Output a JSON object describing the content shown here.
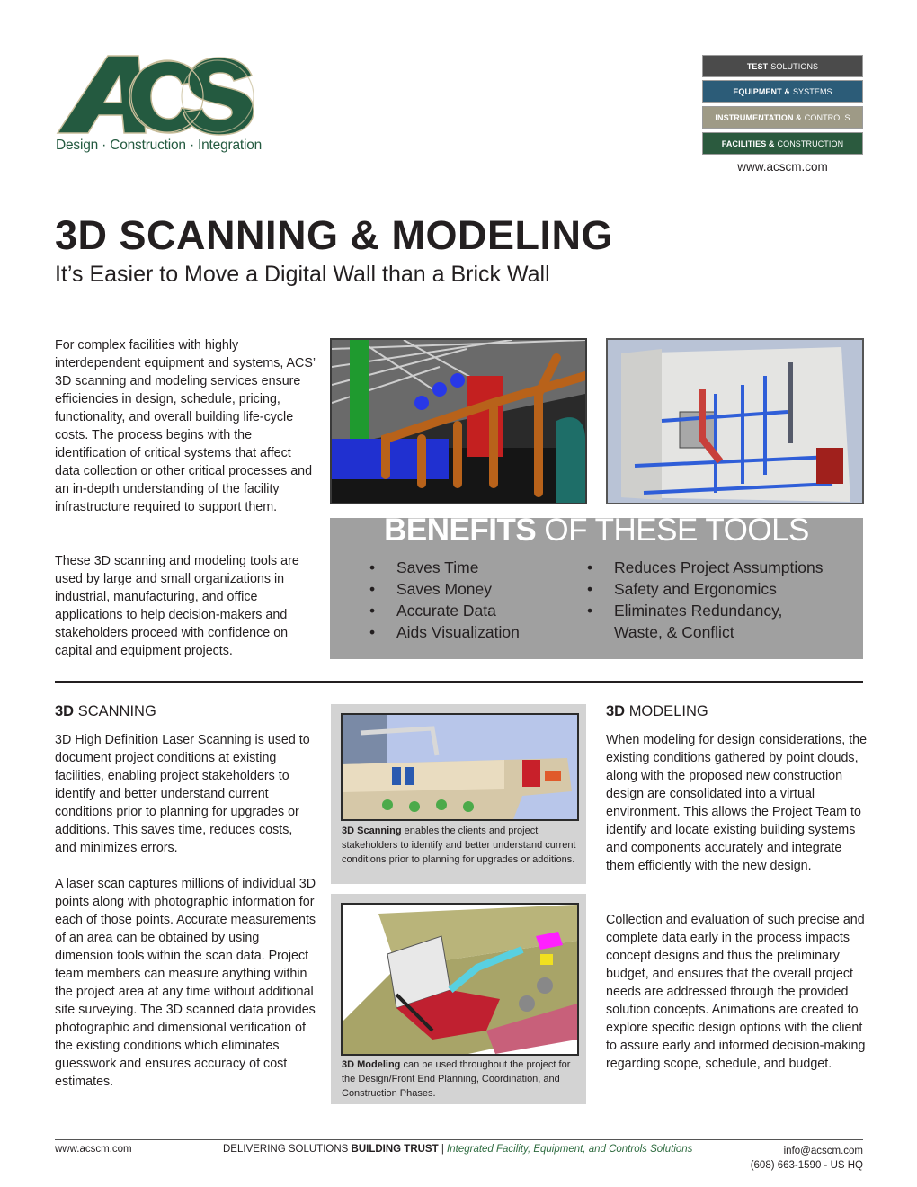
{
  "brand": {
    "logo_text": "ACS",
    "tagline": "Design · Construction · Integration",
    "colors": {
      "green": "#245a40",
      "tan": "#c8bd9a",
      "gray_dark": "#4b4b4b",
      "blue": "#2c5c78",
      "khaki": "#9e9a86",
      "green_badge": "#2b5a3e",
      "benefits_bg": "#a0a0a0",
      "figcard_bg": "#d3d3d3",
      "footer_italic": "#2e6b3f"
    }
  },
  "divisions": [
    {
      "bold": "TEST",
      "light": "SOLUTIONS",
      "color": "#4b4b4b"
    },
    {
      "bold": "EQUIPMENT &",
      "light": "SYSTEMS",
      "color": "#2c5c78"
    },
    {
      "bold": "INSTRUMENTATION &",
      "light": "CONTROLS",
      "color": "#9e9a86"
    },
    {
      "bold": "FACILITIES &",
      "light": "CONSTRUCTION",
      "color": "#2b5a3e"
    }
  ],
  "website": "www.acscm.com",
  "header": {
    "title": "3D SCANNING & MODELING",
    "subtitle": "It’s Easier to Move a Digital Wall than a Brick Wall"
  },
  "intro": {
    "paragraph1": "For complex facilities with highly interdependent equipment and systems, ACS’ 3D scanning and modeling services ensure efficiencies in design, schedule, pricing, functionality, and overall building life-cycle costs. The process begins with the identification of critical systems that affect data collection or other critical processes and an in-depth understanding of the facility infrastructure required to support them.",
    "paragraph2": "These 3D scanning and modeling tools are used by large and small organizations in industrial, manufacturing, and office applications to help decision-makers and stakeholders proceed with confidence on capital and equipment projects."
  },
  "images": {
    "top_left": "3D BIM model of overhead piping and ductwork",
    "top_right": "3D laser scan point cloud of mechanical room wall",
    "scan_fig": "3D scan point cloud of facility cross-section",
    "model_fig": "3D model of industrial building layout"
  },
  "benefits": {
    "title_bold": "BENEFITS",
    "title_light": "OF THESE TOOLS",
    "bullet": "•",
    "left": [
      "Saves Time",
      "Saves Money",
      "Accurate Data",
      "Aids Visualization"
    ],
    "right": [
      "Reduces Project Assumptions",
      "Safety and Ergonomics",
      "Eliminates Redundancy,"
    ],
    "right_continuation": "Waste, & Conflict"
  },
  "scanning": {
    "head_bold": "3D",
    "head_light": "SCANNING",
    "paragraph1": "3D High Definition Laser Scanning is used to document project conditions at existing facilities, enabling project stakeholders to identify and better understand current conditions prior to planning for upgrades or additions. This saves time, reduces costs, and minimizes errors.",
    "paragraph2": "A laser scan captures millions of individual 3D points along with photographic information for each of those points. Accurate measurements of an area can be obtained by using dimension tools within the scan data. Project team members can measure anything within the project area at any time without additional site surveying. The 3D scanned data provides photographic and dimensional verification of the existing conditions which eliminates guesswork and ensures accuracy of cost estimates.",
    "caption_bold": "3D Scanning",
    "caption": " enables the clients and project stakeholders to identify and better understand current conditions prior to planning for upgrades or additions."
  },
  "modeling": {
    "head_bold": "3D",
    "head_light": "MODELING",
    "paragraph1": "When modeling for design considerations, the existing conditions gathered by point clouds, along with the proposed new construction design are consolidated into a virtual environment. This allows the Project Team to identify and locate existing building systems and components accurately and integrate them efficiently with the new design.",
    "paragraph2": "Collection and evaluation of such precise and complete data early in the process impacts concept designs and thus the preliminary budget, and ensures that the overall project needs are addressed through the provided solution concepts. Animations are created to explore specific design options with the client to assure early and informed decision-making regarding scope, schedule, and budget.",
    "caption_bold": "3D Modeling",
    "caption": " can be used throughout the project for the Design/Front End Planning, Coordination, and Construction Phases."
  },
  "footer": {
    "url": "www.acscm.com",
    "slogan_light": "DELIVERING SOLUTIONS",
    "slogan_bold": "BUILDING TRUST",
    "separator": "|",
    "slogan_italic": "Integrated Facility, Equipment, and Controls Solutions",
    "email": "info@acscm.com",
    "phone": "(608) 663-1590 - US HQ"
  }
}
